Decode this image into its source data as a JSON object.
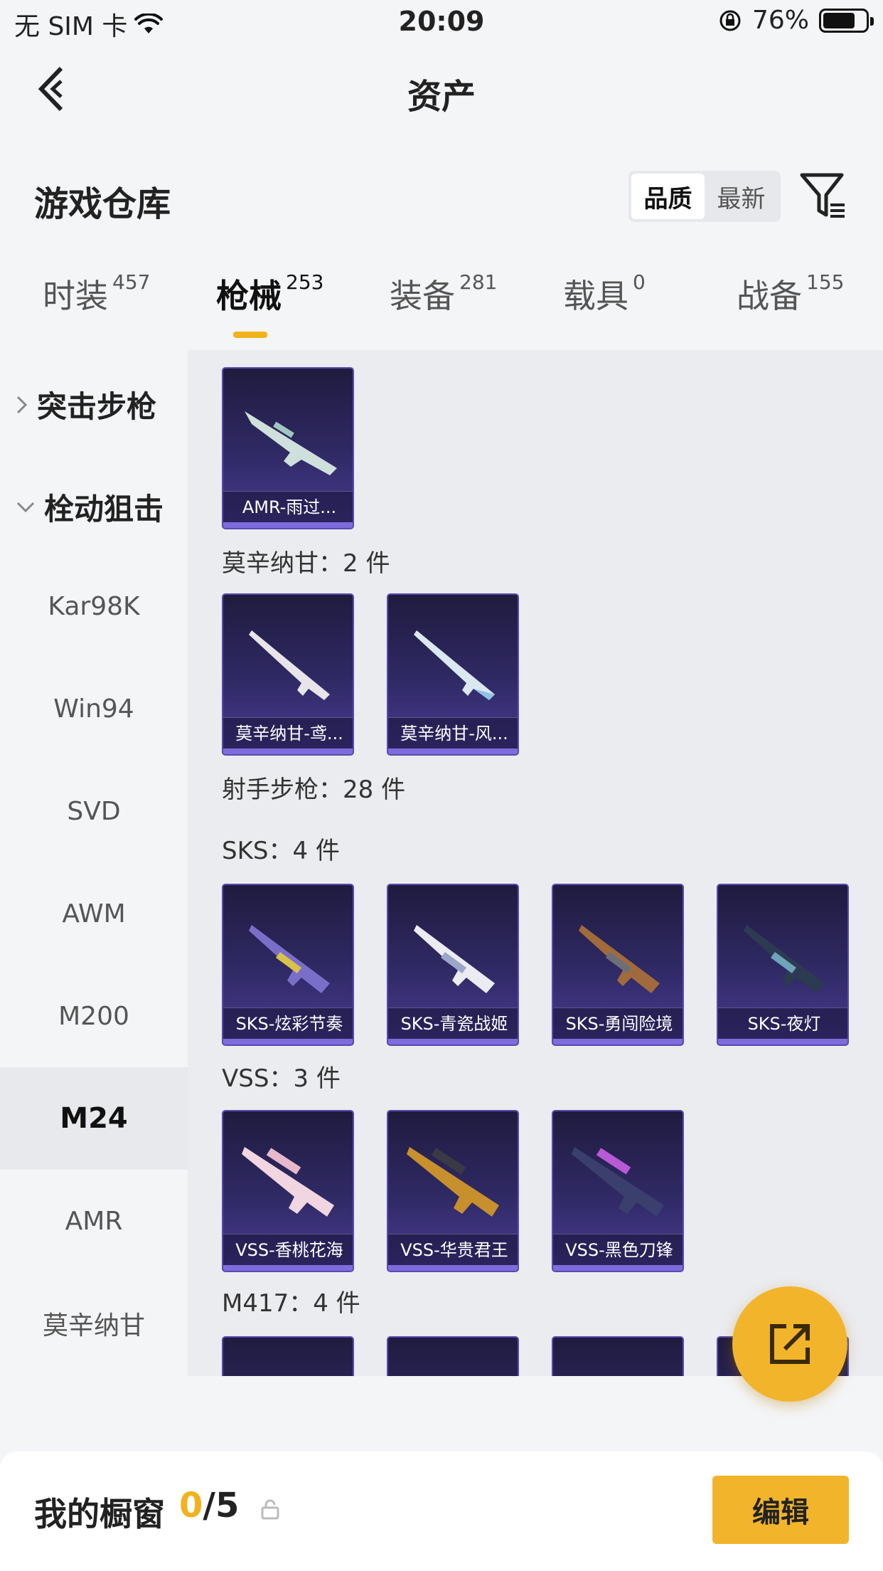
{
  "status_bar": {
    "carrier": "无 SIM 卡",
    "time": "20:09",
    "battery": "76%",
    "battery_level": 0.76
  },
  "nav": {
    "title": "资产"
  },
  "section": {
    "title": "游戏仓库",
    "sort_options": [
      "品质",
      "最新"
    ],
    "active_sort": "品质"
  },
  "tabs": [
    {
      "label": "时装",
      "count": "457"
    },
    {
      "label": "枪械",
      "count": "253"
    },
    {
      "label": "装备",
      "count": "281"
    },
    {
      "label": "载具",
      "count": "0"
    },
    {
      "label": "战备",
      "count": "155"
    }
  ],
  "active_tab": "枪械",
  "sidebar": {
    "groups": [
      {
        "label": "突击步枪",
        "expanded": false
      },
      {
        "label": "栓动狙击",
        "expanded": true
      }
    ],
    "items": [
      "Kar98K",
      "Win94",
      "SVD",
      "AWM",
      "M200",
      "M24",
      "AMR",
      "莫辛纳甘"
    ],
    "active_item": "M24"
  },
  "content": {
    "groups": [
      {
        "label": "",
        "items": [
          "AMR-雨过..."
        ]
      },
      {
        "label": "莫辛纳甘：2 件",
        "items": [
          "莫辛纳甘-鸢...",
          "莫辛纳甘-风..."
        ]
      },
      {
        "label": "射手步枪：28 件",
        "items": []
      },
      {
        "label": "SKS：4 件",
        "items": [
          "SKS-炫彩节奏",
          "SKS-青瓷战姬",
          "SKS-勇闯险境",
          "SKS-夜灯"
        ]
      },
      {
        "label": "VSS：3 件",
        "items": [
          "VSS-香桃花海",
          "VSS-华贵君王",
          "VSS-黑色刀锋"
        ]
      },
      {
        "label": "M417：4 件",
        "items": []
      }
    ]
  },
  "bottom_bar": {
    "title": "我的橱窗",
    "current": "0",
    "total": "/5",
    "edit_label": "编辑"
  }
}
